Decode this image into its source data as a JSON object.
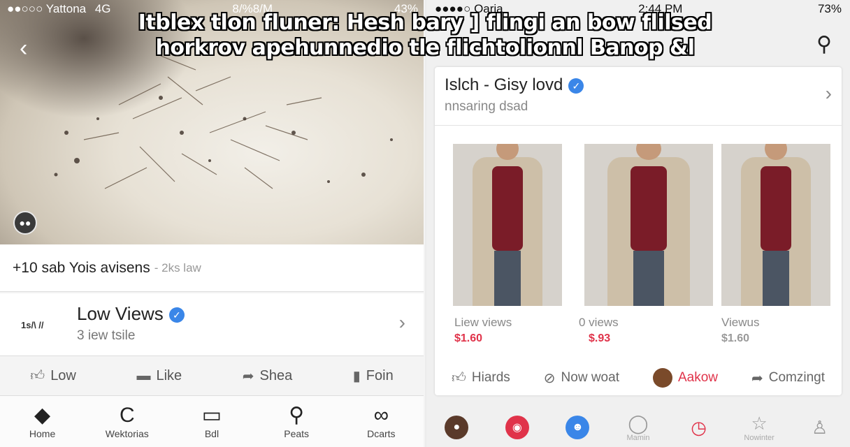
{
  "caption": {
    "line1": "Itblex tlon fluner: Hesh bary ] flingi an bow flilsed",
    "line2": "horkrov apehunnedio tle flichtolionnl Banop &l"
  },
  "left": {
    "status": {
      "carrier": "●●○○○ Yattona",
      "network": "4G",
      "time": "8/%8/M",
      "battery": "43%"
    },
    "video": {
      "views_line": "+10 sab Yois avisens",
      "age": "- 2ks law"
    },
    "channel": {
      "logo": "1s/\\ //",
      "name": "Low Views",
      "sub": "3 iew tsile"
    },
    "actions": [
      {
        "icon": "thumbs-up-icon",
        "label": "Low"
      },
      {
        "icon": "comment-icon",
        "label": "Like"
      },
      {
        "icon": "share-icon",
        "label": "Shea"
      },
      {
        "icon": "bookmark-icon",
        "label": "Foin"
      }
    ],
    "tabs": [
      {
        "icon": "home-icon",
        "label": "Home"
      },
      {
        "icon": "explore-icon",
        "label": "Wektorias"
      },
      {
        "icon": "subscriptions-icon",
        "label": "Bdl"
      },
      {
        "icon": "search-icon",
        "label": "Peats"
      },
      {
        "icon": "people-icon",
        "label": "Dcarts"
      }
    ]
  },
  "right": {
    "status": {
      "carrier": "●●●●○ Oaria",
      "time": "2:44 PM",
      "battery": "73%"
    },
    "channel": {
      "name": "Islch - Gisy lovd",
      "sub": "nnsaring dsad"
    },
    "thumbs": [
      {
        "label": "Liew views",
        "price": "$1.60"
      },
      {
        "label": "0 views",
        "price": "$.93"
      },
      {
        "label": "Viewus",
        "price": "$1.60"
      }
    ],
    "actions": [
      {
        "icon": "thumbs-up-icon",
        "label": "Hiards"
      },
      {
        "icon": "no-video-icon",
        "label": "Now woat"
      },
      {
        "icon": "avatar-icon",
        "label": "Aakow"
      },
      {
        "icon": "share-icon",
        "label": "Comzingt"
      }
    ],
    "bottom_labels": [
      "Mamin",
      "Nowinter"
    ]
  },
  "colors": {
    "accent_red": "#e0334a",
    "verified_blue": "#3a86e8"
  }
}
